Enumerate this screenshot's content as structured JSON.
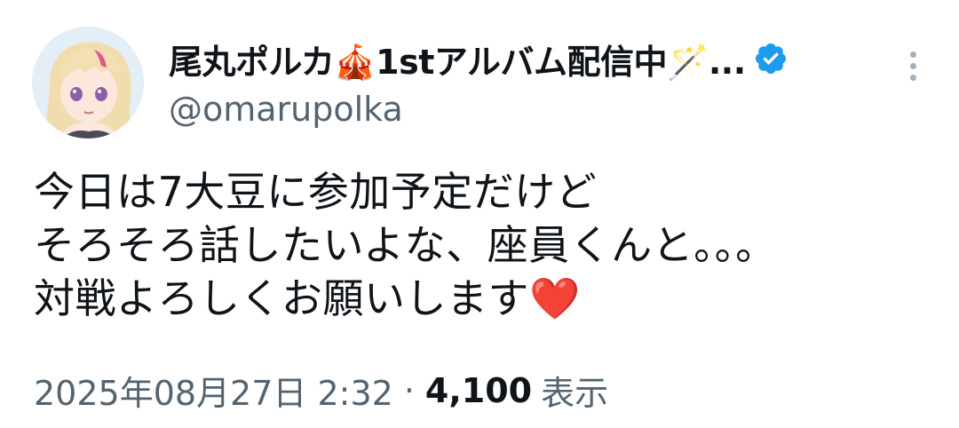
{
  "author": {
    "display_name": "尾丸ポルカ🎪1stアルバム配信中🪄...",
    "handle": "@omarupolka",
    "verified": true
  },
  "tweet": {
    "lines": [
      "今日は7大豆に参加予定だけど",
      "そろそろ話したいよな、座員くんと。。。",
      "対戦よろしくお願いします❤️"
    ]
  },
  "meta": {
    "timestamp": "2025年08月27日 2:32",
    "separator": "·",
    "views_count": "4,100",
    "views_label": "表示"
  },
  "icons": {
    "verified": "verified-badge-icon",
    "more": "more-options-icon"
  },
  "colors": {
    "verified_blue": "#1d9bf0",
    "secondary_text": "#536471",
    "primary_text": "#0f1419"
  }
}
